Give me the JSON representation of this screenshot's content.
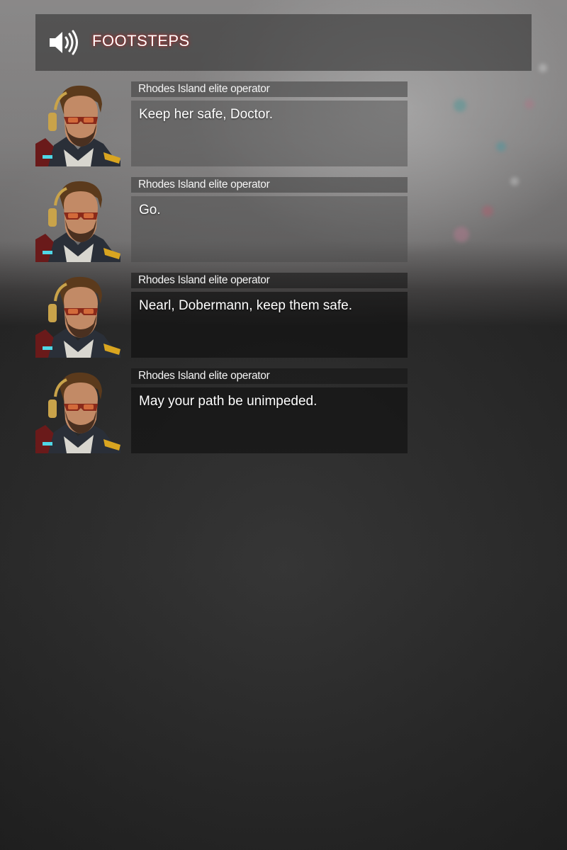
{
  "header": {
    "icon": "speaker-volume-icon",
    "title": "FOOTSTEPS",
    "title_glow_color": "#be2828"
  },
  "dialogue": [
    {
      "portrait": "operator-portrait-icon",
      "speaker": "Rhodes Island elite operator",
      "line": "Keep her safe, Doctor."
    },
    {
      "portrait": "operator-portrait-icon",
      "speaker": "Rhodes Island elite operator",
      "line": "Go."
    },
    {
      "portrait": "operator-portrait-icon",
      "speaker": "Rhodes Island elite operator",
      "line": "Nearl, Dobermann, keep them safe."
    },
    {
      "portrait": "operator-portrait-icon",
      "speaker": "Rhodes Island elite operator",
      "line": "May your path be unimpeded."
    }
  ]
}
